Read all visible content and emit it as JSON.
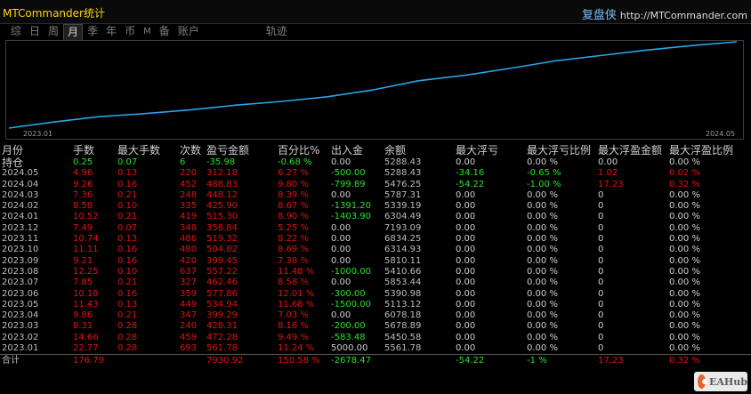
{
  "app_title": "MTCommander统计",
  "brand_cn": "复盘侠",
  "brand_url": "http://MTCommander.com",
  "tabs": [
    {
      "label": "综"
    },
    {
      "label": "日"
    },
    {
      "label": "周"
    },
    {
      "label": "月",
      "active": true
    },
    {
      "label": "季"
    },
    {
      "label": "年"
    },
    {
      "label": "币"
    },
    {
      "label": "M"
    },
    {
      "label": "备"
    },
    {
      "label": "账户"
    },
    {
      "label": "轨迹"
    }
  ],
  "chart": {
    "x_start": "2023.01",
    "x_end": "2024.05",
    "line_color": "#2aa5ea",
    "values": [
      0,
      8,
      15,
      19,
      24,
      30,
      35,
      41,
      50,
      62,
      69,
      78,
      88,
      95,
      102,
      108,
      113
    ]
  },
  "columns": [
    "月份",
    "手数",
    "最大手数",
    "次数",
    "盈亏金额",
    "百分比%",
    "出入金",
    "余额",
    "最大浮亏",
    "最大浮亏比例",
    "最大浮盈金额",
    "最大浮盈比例"
  ],
  "holding": {
    "label": "持仓",
    "lots": "0.25",
    "max_lots": "0.07",
    "count": "6",
    "pl": "-35.98",
    "pct": "-0.68 %",
    "flow": "0.00",
    "balance": "5288.43",
    "mdd": "0.00",
    "mdd_pct": "0.00 %",
    "mfp": "0.00",
    "mfp_pct": "0.00 %"
  },
  "rows": [
    {
      "month": "2024.05",
      "lots": "4.96",
      "max_lots": "0.13",
      "count": "220",
      "pl": "312.18",
      "pct": "6.27 %",
      "flow": "-500.00",
      "balance": "5288.43",
      "mdd": "-34.16",
      "mdd_pct": "-0.65 %",
      "mfp": "1.02",
      "mfp_pct": "0.02 %"
    },
    {
      "month": "2024.04",
      "lots": "9.26",
      "max_lots": "0.16",
      "count": "452",
      "pl": "488.83",
      "pct": "9.80 %",
      "flow": "-799.89",
      "balance": "5476.25",
      "mdd": "-54.22",
      "mdd_pct": "-1.00 %",
      "mfp": "17.23",
      "mfp_pct": "0.32 %"
    },
    {
      "month": "2024.03",
      "lots": "7.36",
      "max_lots": "0.21",
      "count": "248",
      "pl": "448.12",
      "pct": "8.39 %",
      "flow": "0.00",
      "balance": "5787.31",
      "mdd": "0.00",
      "mdd_pct": "0.00 %",
      "mfp": "0",
      "mfp_pct": "0.00 %"
    },
    {
      "month": "2024.02",
      "lots": "8.58",
      "max_lots": "0.10",
      "count": "335",
      "pl": "425.90",
      "pct": "8.67 %",
      "flow": "-1391.20",
      "balance": "5339.19",
      "mdd": "0.00",
      "mdd_pct": "0.00 %",
      "mfp": "0",
      "mfp_pct": "0.00 %"
    },
    {
      "month": "2024.01",
      "lots": "10.52",
      "max_lots": "0.21",
      "count": "419",
      "pl": "515.30",
      "pct": "8.90 %",
      "flow": "-1403.90",
      "balance": "6304.49",
      "mdd": "0.00",
      "mdd_pct": "0.00 %",
      "mfp": "0",
      "mfp_pct": "0.00 %"
    },
    {
      "month": "2023.12",
      "lots": "7.49",
      "max_lots": "0.07",
      "count": "348",
      "pl": "358.84",
      "pct": "5.25 %",
      "flow": "0.00",
      "balance": "7193.09",
      "mdd": "0.00",
      "mdd_pct": "0.00 %",
      "mfp": "0",
      "mfp_pct": "0.00 %"
    },
    {
      "month": "2023.11",
      "lots": "10.74",
      "max_lots": "0.13",
      "count": "486",
      "pl": "519.32",
      "pct": "8.22 %",
      "flow": "0.00",
      "balance": "6834.25",
      "mdd": "0.00",
      "mdd_pct": "0.00 %",
      "mfp": "0",
      "mfp_pct": "0.00 %"
    },
    {
      "month": "2023.10",
      "lots": "11.11",
      "max_lots": "0.16",
      "count": "480",
      "pl": "504.82",
      "pct": "8.69 %",
      "flow": "0.00",
      "balance": "6314.93",
      "mdd": "0.00",
      "mdd_pct": "0.00 %",
      "mfp": "0",
      "mfp_pct": "0.00 %"
    },
    {
      "month": "2023.09",
      "lots": "9.21",
      "max_lots": "0.16",
      "count": "420",
      "pl": "399.45",
      "pct": "7.38 %",
      "flow": "0.00",
      "balance": "5810.11",
      "mdd": "0.00",
      "mdd_pct": "0.00 %",
      "mfp": "0",
      "mfp_pct": "0.00 %"
    },
    {
      "month": "2023.08",
      "lots": "12.25",
      "max_lots": "0.10",
      "count": "637",
      "pl": "557.22",
      "pct": "11.48 %",
      "flow": "-1000.00",
      "balance": "5410.66",
      "mdd": "0.00",
      "mdd_pct": "0.00 %",
      "mfp": "0",
      "mfp_pct": "0.00 %"
    },
    {
      "month": "2023.07",
      "lots": "7.85",
      "max_lots": "0.21",
      "count": "327",
      "pl": "462.46",
      "pct": "8.58 %",
      "flow": "0.00",
      "balance": "5853.44",
      "mdd": "0.00",
      "mdd_pct": "0.00 %",
      "mfp": "0",
      "mfp_pct": "0.00 %"
    },
    {
      "month": "2023.06",
      "lots": "10.18",
      "max_lots": "0.16",
      "count": "359",
      "pl": "577.86",
      "pct": "12.01 %",
      "flow": "-300.00",
      "balance": "5390.98",
      "mdd": "0.00",
      "mdd_pct": "0.00 %",
      "mfp": "0",
      "mfp_pct": "0.00 %"
    },
    {
      "month": "2023.05",
      "lots": "11.43",
      "max_lots": "0.13",
      "count": "449",
      "pl": "534.94",
      "pct": "11.68 %",
      "flow": "-1500.00",
      "balance": "5113.12",
      "mdd": "0.00",
      "mdd_pct": "0.00 %",
      "mfp": "0",
      "mfp_pct": "0.00 %"
    },
    {
      "month": "2023.04",
      "lots": "9.86",
      "max_lots": "0.21",
      "count": "347",
      "pl": "399.29",
      "pct": "7.03 %",
      "flow": "0.00",
      "balance": "6078.18",
      "mdd": "0.00",
      "mdd_pct": "0.00 %",
      "mfp": "0",
      "mfp_pct": "0.00 %"
    },
    {
      "month": "2023.03",
      "lots": "8.31",
      "max_lots": "0.28",
      "count": "240",
      "pl": "428.31",
      "pct": "8.16 %",
      "flow": "-200.00",
      "balance": "5678.89",
      "mdd": "0.00",
      "mdd_pct": "0.00 %",
      "mfp": "0",
      "mfp_pct": "0.00 %"
    },
    {
      "month": "2023.02",
      "lots": "14.66",
      "max_lots": "0.28",
      "count": "459",
      "pl": "472.28",
      "pct": "9.49 %",
      "flow": "-583.48",
      "balance": "5450.58",
      "mdd": "0.00",
      "mdd_pct": "0.00 %",
      "mfp": "0",
      "mfp_pct": "0.00 %"
    },
    {
      "month": "2023.01",
      "lots": "22.77",
      "max_lots": "0.28",
      "count": "693",
      "pl": "561.78",
      "pct": "11.24 %",
      "flow": "5000.00",
      "balance": "5561.78",
      "mdd": "0.00",
      "mdd_pct": "0.00 %",
      "mfp": "0",
      "mfp_pct": "0.00 %"
    }
  ],
  "totals": {
    "label": "合计",
    "lots": "176.79",
    "pl": "7930.92",
    "pct": "150.58 %",
    "flow": "-2678.47",
    "mdd": "-54.22",
    "mdd_pct": "-1 %",
    "mfp": "17.23",
    "mfp_pct": "0.32 %"
  },
  "watermark": {
    "text": "EAHub",
    "icon": "eahub-logo-icon"
  }
}
